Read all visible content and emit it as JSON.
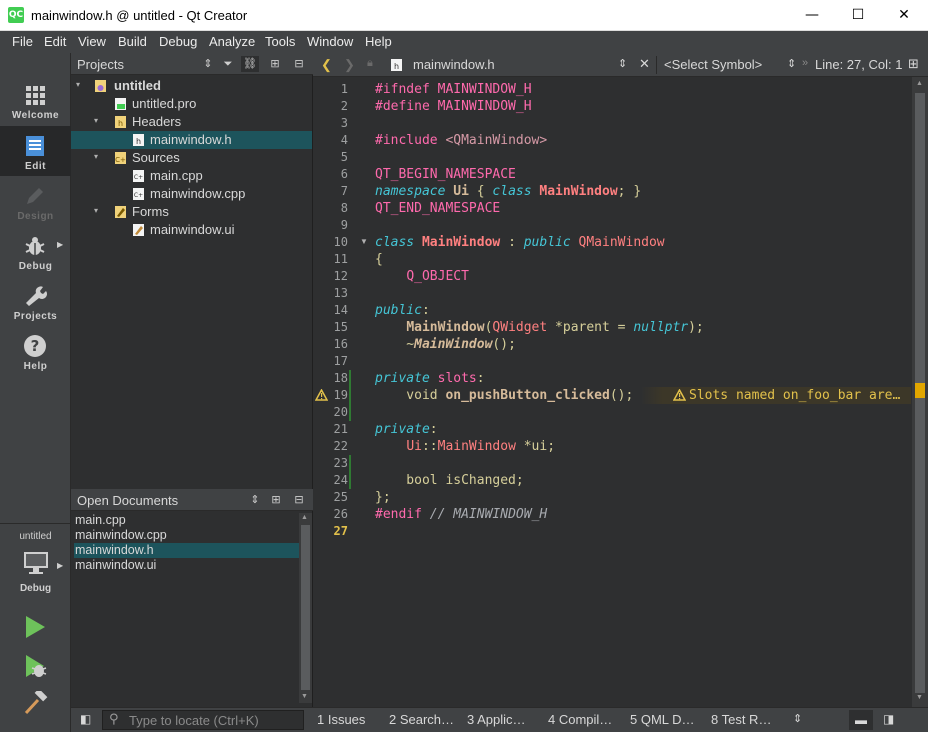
{
  "window": {
    "title": "mainwindow.h @ untitled - Qt Creator",
    "app_icon_text": "QC",
    "minimize": "—",
    "maximize": "☐",
    "close": "✕"
  },
  "menu": [
    "File",
    "Edit",
    "View",
    "Build",
    "Debug",
    "Analyze",
    "Tools",
    "Window",
    "Help"
  ],
  "modes": [
    {
      "label": "Welcome",
      "icon": "grid-icon"
    },
    {
      "label": "Edit",
      "icon": "document-icon"
    },
    {
      "label": "Design",
      "icon": "pencil-icon"
    },
    {
      "label": "Debug",
      "icon": "bug-icon"
    },
    {
      "label": "Projects",
      "icon": "wrench-icon"
    },
    {
      "label": "Help",
      "icon": "question-icon"
    }
  ],
  "kit": {
    "project": "untitled",
    "label": "Debug"
  },
  "projects_pane": {
    "title": "Projects",
    "tree": [
      {
        "label": "untitled",
        "level": 0,
        "bold": true,
        "arrow": "▾"
      },
      {
        "label": "untitled.pro",
        "level": 1
      },
      {
        "label": "Headers",
        "level": 1,
        "arrow": "▾"
      },
      {
        "label": "mainwindow.h",
        "level": 2,
        "selected": true
      },
      {
        "label": "Sources",
        "level": 1,
        "arrow": "▾"
      },
      {
        "label": "main.cpp",
        "level": 2
      },
      {
        "label": "mainwindow.cpp",
        "level": 2
      },
      {
        "label": "Forms",
        "level": 1,
        "arrow": "▾"
      },
      {
        "label": "mainwindow.ui",
        "level": 2
      }
    ]
  },
  "open_documents": {
    "title": "Open Documents",
    "items": [
      "main.cpp",
      "mainwindow.cpp",
      "mainwindow.h",
      "mainwindow.ui"
    ],
    "selected": "mainwindow.h"
  },
  "editor_toolbar": {
    "filename": "mainwindow.h",
    "symbol": "<Select Symbol>",
    "position": "Line: 27, Col: 1"
  },
  "editor": {
    "current_line": 27,
    "warning_line": 19,
    "warning_text": "Slots named on_foo_bar are…",
    "line_numbers": [
      "1",
      "2",
      "3",
      "4",
      "5",
      "6",
      "7",
      "8",
      "9",
      "10",
      "11",
      "12",
      "13",
      "14",
      "15",
      "16",
      "17",
      "18",
      "19",
      "20",
      "21",
      "22",
      "23",
      "24",
      "25",
      "26",
      "27"
    ]
  },
  "statusbar": {
    "locate_placeholder": "Type to locate (Ctrl+K)",
    "tabs": [
      "1 Issues",
      "2 Search…",
      "3 Applic…",
      "4 Compil…",
      "5 QML D…",
      "8 Test R…"
    ]
  },
  "colors": {
    "accent_selection": "#1d545c",
    "warning": "#e2c14b",
    "run_green": "#6ec25b"
  }
}
